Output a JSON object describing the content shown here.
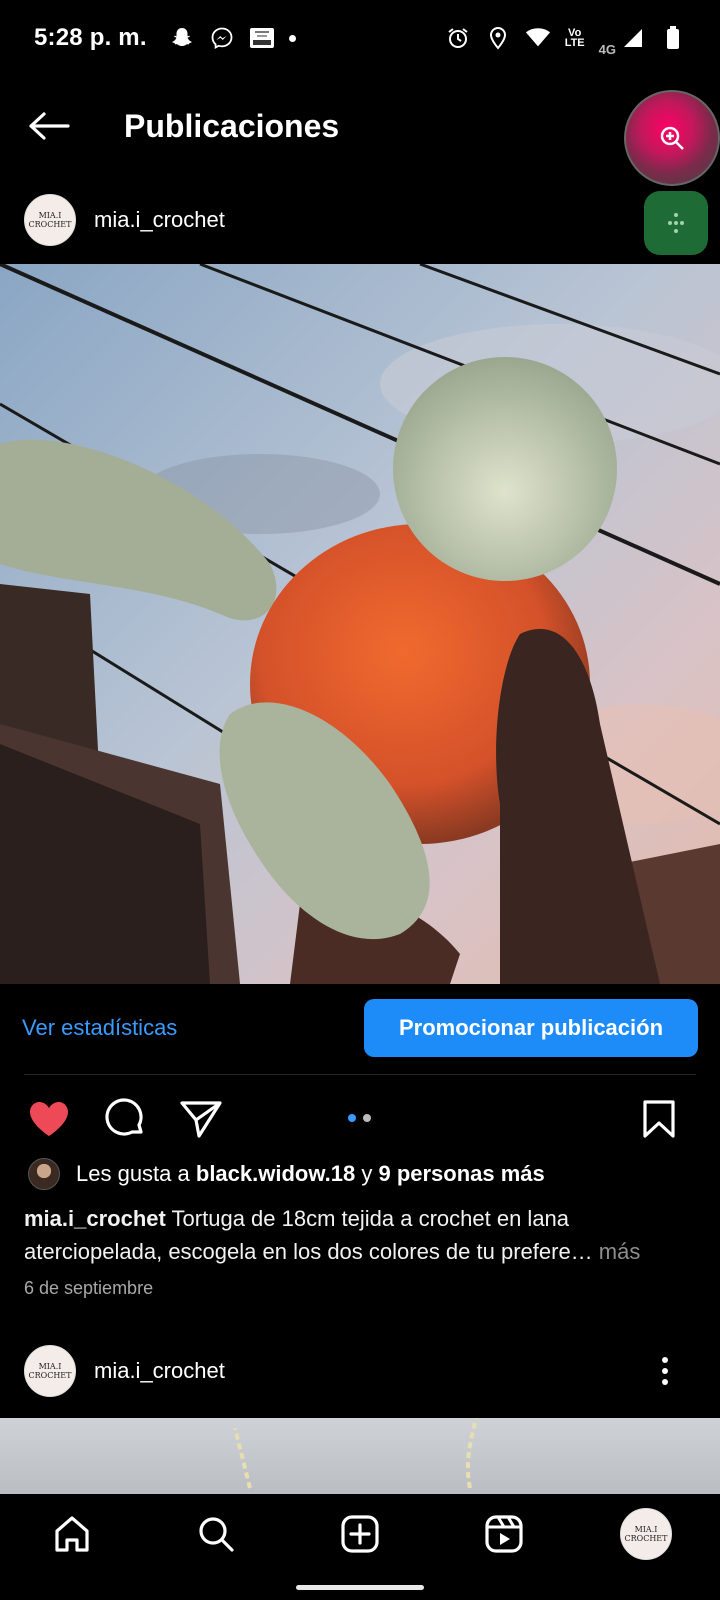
{
  "status_bar": {
    "time": "5:28 p. m.",
    "left_icons": [
      "snapchat-icon",
      "messenger-icon",
      "app-notification-icon",
      "notification-dot"
    ],
    "right_icons": [
      "alarm-icon",
      "location-icon",
      "wifi-icon",
      "volte-icon",
      "signal-icon",
      "battery-icon"
    ],
    "volte_line1": "Vo",
    "volte_line2": "LTE",
    "network": "4G"
  },
  "header": {
    "title": "Publicaciones",
    "back_icon": "arrow-left-icon"
  },
  "post": {
    "username": "mia.i_crochet",
    "avatar_text_line1": "MIA.I",
    "avatar_text_line2": "CROCHET",
    "view_stats_label": "Ver estadísticas",
    "promote_label": "Promocionar publicación",
    "liked": true,
    "carousel_count": 2,
    "carousel_active": 0,
    "likes_prefix": "Les gusta a ",
    "likes_user": "black.widow.18",
    "likes_middle": " y ",
    "likes_others": "9 personas más",
    "caption_user": "mia.i_crochet",
    "caption_text": " Tortuga de 18cm tejida a crochet en lana aterciopelada, escogela en los dos colores de tu prefere…",
    "caption_more": " más",
    "date": "6 de septiembre"
  },
  "post2": {
    "username": "mia.i_crochet",
    "avatar_text_line1": "MIA.I",
    "avatar_text_line2": "CROCHET"
  },
  "bottom_nav": {
    "items": [
      "home-icon",
      "search-icon",
      "create-icon",
      "reels-icon",
      "profile-avatar"
    ]
  },
  "colors": {
    "background": "#000000",
    "accent_blue": "#1d8cf8",
    "link_blue": "#3a9bff",
    "like_red": "#ed4956"
  }
}
